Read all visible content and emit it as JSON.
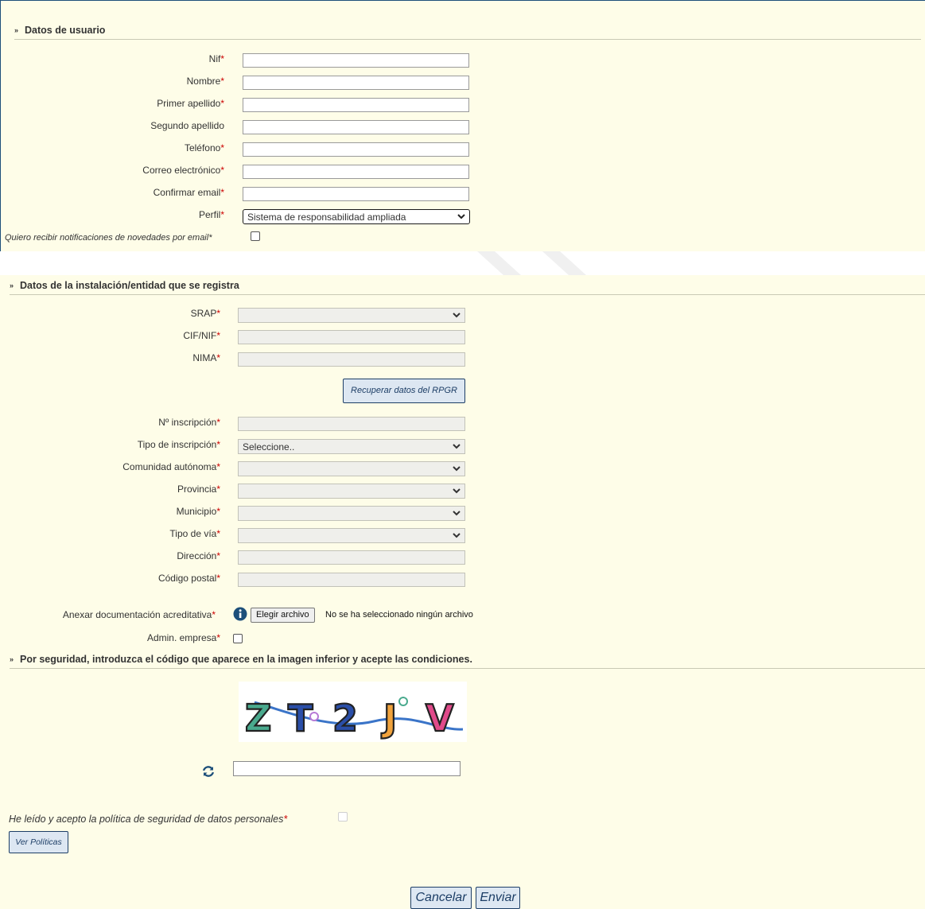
{
  "section_user": {
    "title": "Datos de usuario",
    "labels": {
      "nif": "Nif",
      "nombre": "Nombre",
      "primer_apellido": "Primer apellido",
      "segundo_apellido": "Segundo apellido",
      "telefono": "Teléfono",
      "correo": "Correo electrónico",
      "confirmar_email": "Confirmar email",
      "perfil": "Perfil"
    },
    "perfil_selected": "Sistema de responsabilidad ampliada",
    "notify_label": "Quiero recibir notificaciones de novedades por email"
  },
  "section_entity": {
    "title": "Datos de la instalación/entidad que se registra",
    "labels": {
      "srap": "SRAP",
      "cif": "CIF/NIF",
      "nima": "NIMA",
      "inscripcion": "Nº inscripción",
      "tipo_inscripcion": "Tipo de inscripción",
      "comunidad": "Comunidad autónoma",
      "provincia": "Provincia",
      "municipio": "Municipio",
      "tipo_via": "Tipo de vía",
      "direccion": "Dirección",
      "codigo_postal": "Código postal",
      "anexar": "Anexar documentación acreditativa",
      "admin": "Admin. empresa"
    },
    "tipo_inscripcion_selected": "Seleccione..",
    "recuperar_button": "Recuperar datos del RPGR",
    "file_button": "Elegir archivo",
    "file_status": "No se ha seleccionado ningún archivo"
  },
  "section_security": {
    "title": "Por seguridad, introduzca el código que aparece en la imagen inferior y acepte las condiciones.",
    "captcha_chars": [
      "Z",
      "T",
      "2",
      "J",
      "V"
    ],
    "captcha_colors": [
      "#4aaa8e",
      "#2a4ea8",
      "#2a4ea8",
      "#f0a23c",
      "#e04a8a"
    ],
    "policy_label": "He leído y acepto la política de seguridad de datos personales",
    "ver_politicas": "Ver Políticas"
  },
  "required_mark": "*",
  "footer": {
    "cancel": "Cancelar",
    "submit": "Enviar"
  },
  "colors": {
    "panel_bg": "#fefde8",
    "required": "#cc0000",
    "button_text": "#1d3e66",
    "frame": "#1d4f7a"
  }
}
